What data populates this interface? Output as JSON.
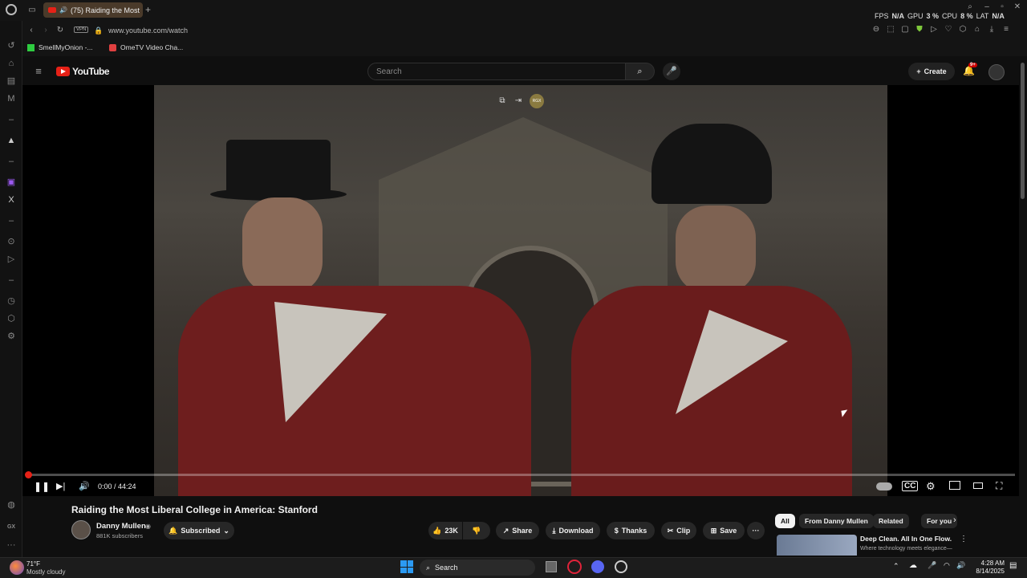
{
  "browser": {
    "tab_title": "(75) Raiding the Most",
    "new_tab_label": "+",
    "vpn_label": "VPN",
    "url": "www.youtube.com/watch",
    "bookmarks": [
      {
        "label": "SmellMyOnion -..."
      },
      {
        "label": "OmeTV Video Cha..."
      }
    ],
    "stats": {
      "fps_label": "FPS",
      "fps_value": "N/A",
      "gpu_label": "GPU",
      "gpu_value": "3 %",
      "cpu_label": "CPU",
      "cpu_value": "8 %",
      "lat_label": "LAT",
      "lat_value": "N/A"
    },
    "sidebar_gx_label": "GX"
  },
  "youtube": {
    "logo_text": "YouTube",
    "search_placeholder": "Search",
    "create_label": "Create",
    "notification_badge": "9+",
    "video": {
      "time": "0:00 / 44:24",
      "progress": 0.0,
      "overlay_badge": "RGX"
    },
    "title": "Raiding the Most Liberal College in America: Stanford",
    "channel": {
      "name": "Danny Mullen",
      "subscribers": "881K subscribers",
      "subscribed_label": "Subscribed"
    },
    "actions": {
      "likes": "23K",
      "share": "Share",
      "download": "Download",
      "thanks": "Thanks",
      "clip": "Clip",
      "save": "Save",
      "more": "···"
    },
    "chips": [
      "All",
      "From Danny Mullen",
      "Related",
      "For you"
    ],
    "suggestion": {
      "title": "Deep Clean. All In One Flow.",
      "subtitle": "Where technology meets elegance—"
    }
  },
  "taskbar": {
    "weather_temp": "71°F",
    "weather_desc": "Mostly cloudy",
    "search_label": "Search",
    "time": "4:28 AM",
    "date": "8/14/2025"
  },
  "colors": {
    "accent_red": "#e62117",
    "background": "#0f0f0f",
    "chip_bg": "#272727"
  }
}
